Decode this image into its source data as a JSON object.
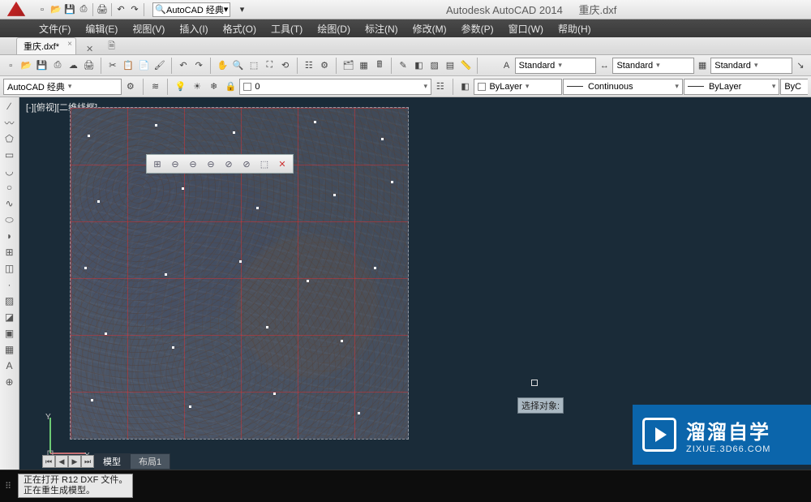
{
  "title": {
    "app": "Autodesk AutoCAD 2014",
    "file": "重庆.dxf"
  },
  "workspace_dropdown": "AutoCAD 经典",
  "menus": [
    "文件(F)",
    "编辑(E)",
    "视图(V)",
    "插入(I)",
    "格式(O)",
    "工具(T)",
    "绘图(D)",
    "标注(N)",
    "修改(M)",
    "参数(P)",
    "窗口(W)",
    "帮助(H)"
  ],
  "doc_tab": {
    "label": "重庆.dxf*"
  },
  "ribbon_row2": {
    "workspace": "AutoCAD 经典",
    "layer_combo": "0",
    "bylayer1": "ByLayer",
    "linetype": "Continuous",
    "bylayer2": "ByLayer",
    "byc": "ByC",
    "style1": "Standard",
    "style2": "Standard",
    "style3": "Standard"
  },
  "viewport_label": "[-][俯视][二维线框]",
  "tooltip_text": "选择对象:",
  "layout_tabs": {
    "model": "模型",
    "layout1": "布局1"
  },
  "cmd_history": {
    "line1": "正在打开 R12 DXF 文件。",
    "line2": "正在重生成模型。"
  },
  "watermark": {
    "text": "溜溜自学",
    "url": "ZIXUE.3D66.COM"
  },
  "qat_icons": [
    "new",
    "open",
    "save",
    "saveall",
    "sep",
    "print",
    "sep",
    "undo",
    "redo",
    "sep"
  ],
  "toolbar1_icons": [
    "new",
    "open",
    "save",
    "saveas",
    "publish",
    "plot",
    "sep",
    "cut",
    "copy",
    "paste",
    "match",
    "sep",
    "undo",
    "redo",
    "sep",
    "pan",
    "zoomrt",
    "zoomwin",
    "zoomext",
    "zoomprev",
    "sep",
    "props",
    "dsettings",
    "sep",
    "sheetset",
    "toolpalette",
    "calc",
    "sep",
    "markup",
    "block",
    "hatch",
    "table",
    "measure"
  ],
  "toolbar1_right_icons": [
    "textstyle",
    "dimstyle",
    "tablestyle",
    "mleader"
  ],
  "toolbar2_icons": [
    "layeriso",
    "freeze",
    "layoff",
    "layon",
    "laylock",
    "layunlock"
  ],
  "left_tools": [
    "line",
    "pline",
    "circle",
    "arc",
    "polygon",
    "rectangle",
    "ellipse",
    "spline",
    "hatch",
    "point",
    "region",
    "block",
    "insert",
    "mtext",
    "table",
    "move",
    "copy",
    "rotate",
    "trim",
    "offset",
    "text"
  ],
  "view_float_icons": [
    "plan",
    "view-sw",
    "view-se",
    "view-ne",
    "view-nw",
    "shade",
    "wire",
    "close"
  ]
}
